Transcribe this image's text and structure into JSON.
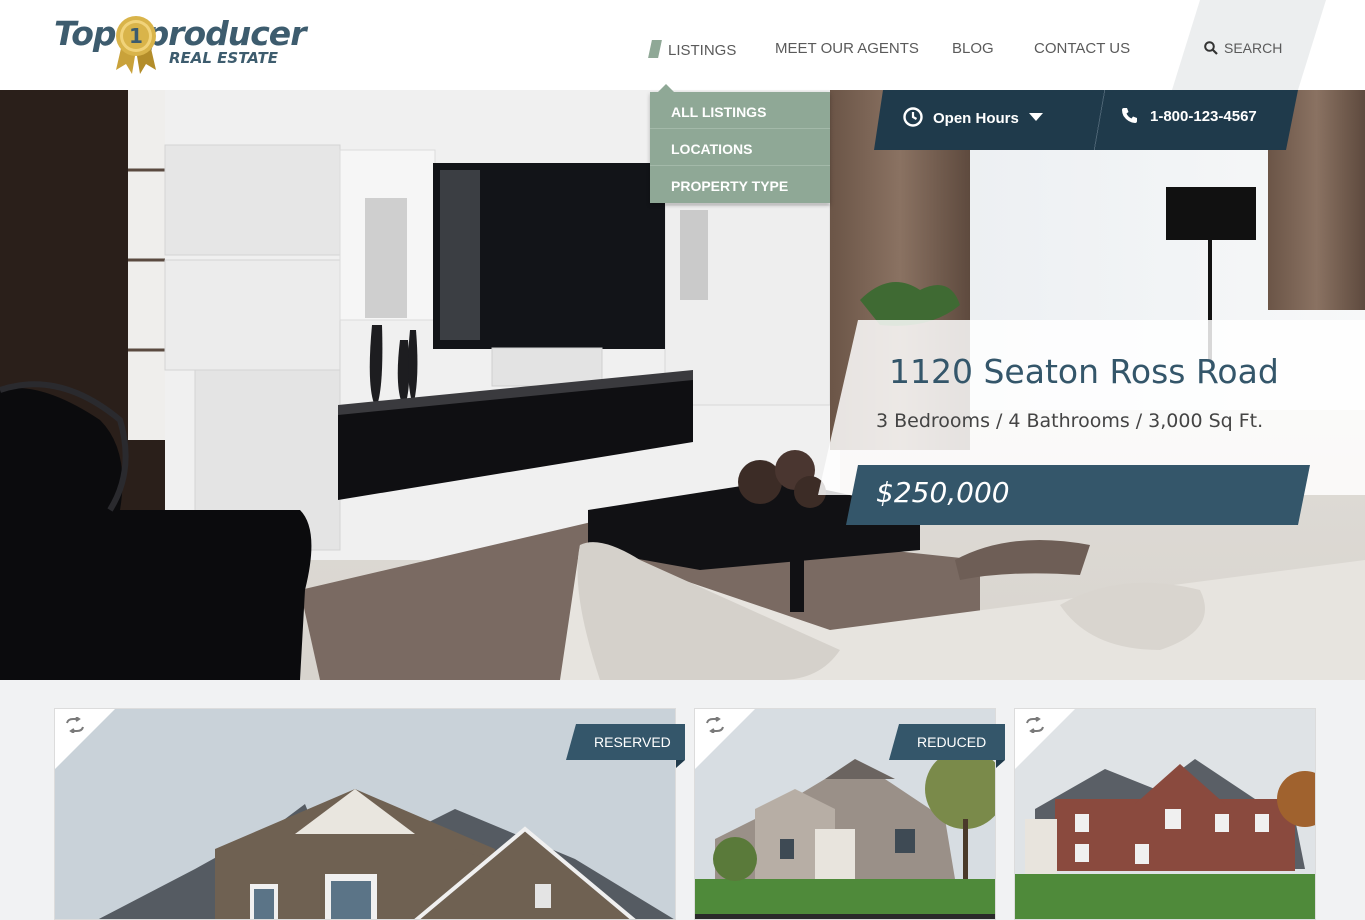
{
  "brand": {
    "logo_top": "Top",
    "logo_top_rest": "producer",
    "logo_sub": "REAL ESTATE",
    "medal_number": "1"
  },
  "nav": {
    "items": [
      "LISTINGS",
      "MEET OUR AGENTS",
      "BLOG",
      "CONTACT US"
    ],
    "search_label": "SEARCH",
    "dropdown": [
      "ALL LISTINGS",
      "LOCATIONS",
      "PROPERTY TYPE"
    ]
  },
  "info_bar": {
    "hours_label": "Open Hours",
    "phone": "1-800-123-4567"
  },
  "featured": {
    "address": "1120 Seaton Ross Road",
    "bedrooms": "3 Bedrooms",
    "bathrooms": "4 Bathrooms",
    "area": "3,000 Sq Ft.",
    "separator": "/",
    "price": "$250,000"
  },
  "cards": [
    {
      "badge": "RESERVED",
      "icon": "swap-icon"
    },
    {
      "badge": "REDUCED",
      "icon": "swap-icon"
    },
    {
      "badge": "",
      "icon": "swap-icon"
    }
  ],
  "colors": {
    "navy": "#1f3a4b",
    "slate": "#34566a",
    "sage": "#8fa896",
    "gold": "#c9a23a"
  }
}
